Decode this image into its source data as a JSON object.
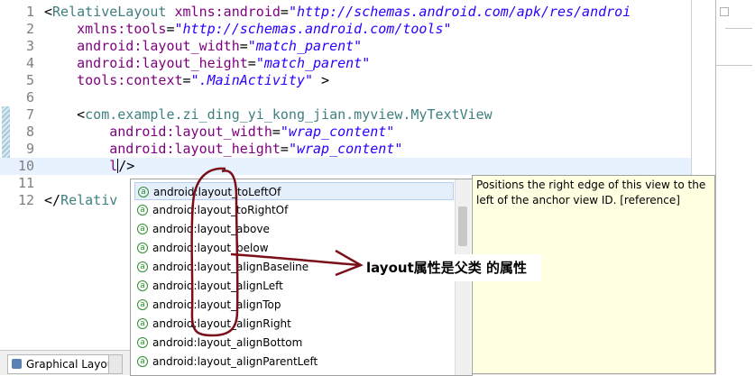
{
  "editor": {
    "line_numbers": [
      "1",
      "2",
      "3",
      "4",
      "5",
      "6",
      "7",
      "8",
      "9",
      "10",
      "11",
      "12"
    ],
    "lines": [
      [
        {
          "k": "plain",
          "t": "<"
        },
        {
          "k": "tag",
          "t": "RelativeLayout "
        },
        {
          "k": "attr",
          "t": "xmlns:android"
        },
        {
          "k": "plain",
          "t": "="
        },
        {
          "k": "val",
          "t": "\"http://schemas.android.com/apk/res/androi"
        }
      ],
      [
        {
          "k": "plain",
          "t": "    "
        },
        {
          "k": "attr",
          "t": "xmlns:tools"
        },
        {
          "k": "plain",
          "t": "="
        },
        {
          "k": "val",
          "t": "\"http://schemas.android.com/tools\""
        }
      ],
      [
        {
          "k": "plain",
          "t": "    "
        },
        {
          "k": "attr",
          "t": "android:layout_width"
        },
        {
          "k": "plain",
          "t": "="
        },
        {
          "k": "val",
          "t": "\"match_parent\""
        }
      ],
      [
        {
          "k": "plain",
          "t": "    "
        },
        {
          "k": "attr",
          "t": "android:layout_height"
        },
        {
          "k": "plain",
          "t": "="
        },
        {
          "k": "val",
          "t": "\"match_parent\""
        }
      ],
      [
        {
          "k": "plain",
          "t": "    "
        },
        {
          "k": "attr",
          "t": "tools:context"
        },
        {
          "k": "plain",
          "t": "="
        },
        {
          "k": "val",
          "t": "\".MainActivity\""
        },
        {
          "k": "plain",
          "t": " >"
        }
      ],
      [],
      [
        {
          "k": "plain",
          "t": "    <"
        },
        {
          "k": "tag",
          "t": "com.example.zi_ding_yi_kong_jian.myview.MyTextView"
        }
      ],
      [
        {
          "k": "plain",
          "t": "        "
        },
        {
          "k": "attr",
          "t": "android:layout_width"
        },
        {
          "k": "plain",
          "t": "="
        },
        {
          "k": "val",
          "t": "\"wrap_content\""
        }
      ],
      [
        {
          "k": "plain",
          "t": "        "
        },
        {
          "k": "attr",
          "t": "android:layout_height"
        },
        {
          "k": "plain",
          "t": "="
        },
        {
          "k": "val",
          "t": "\"wrap_content\""
        }
      ],
      [
        {
          "k": "plain",
          "t": "        "
        },
        {
          "k": "attr",
          "t": "l"
        },
        {
          "k": "caret",
          "t": ""
        },
        {
          "k": "plain",
          "t": "/>"
        }
      ],
      [],
      [
        {
          "k": "plain",
          "t": "</"
        },
        {
          "k": "tag",
          "t": "Relativ"
        }
      ]
    ]
  },
  "autocomplete": {
    "items": [
      "android:layout_toLeftOf",
      "android:layout_toRightOf",
      "android:layout_above",
      "android:layout_below",
      "android:layout_alignBaseline",
      "android:layout_alignLeft",
      "android:layout_alignTop",
      "android:layout_alignRight",
      "android:layout_alignBottom",
      "android:layout_alignParentLeft"
    ],
    "item_icon_glyph": "a",
    "selected_index": 0
  },
  "doc_tooltip": {
    "text": "Positions the right edge of this view to the left of the anchor view ID. [reference]"
  },
  "annotation": {
    "text": "layout属性是父类 的属性",
    "ink_color": "#7a0f1a"
  },
  "bottom_tabs": {
    "graphical_layout": "Graphical Layout"
  }
}
